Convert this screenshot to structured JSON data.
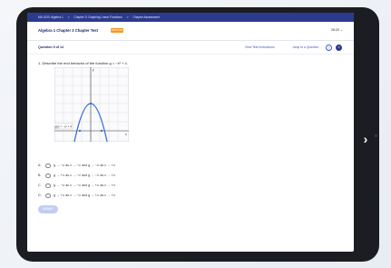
{
  "breadcrumb": {
    "items": [
      "MA 1020: Algebra 1",
      "Chapter 3: Graphing Linear Functions",
      "Chapter Assessment"
    ],
    "separator": ">"
  },
  "header": {
    "title": "Algebra 1 Chapter 3 Chapter Test",
    "badge": "PRACTICE",
    "timer": "28:00 ⌄"
  },
  "question_bar": {
    "counter": "Question 5 of 14",
    "view_instructions": "View Test Instructions",
    "jump_to_question": "Jump to a Question",
    "help_icon_label": "?",
    "menu_icon_label": "≡"
  },
  "question": {
    "prompt": "1. Describe the end behavior of the function g = −x² + 4.",
    "graph_label": "g(x) = −x² + 4",
    "axis_y": "y",
    "axis_x": "x"
  },
  "choices": [
    {
      "letter": "A.",
      "text": "g → −∞ as x → −∞ and g → −∞ as x → +∞"
    },
    {
      "letter": "B.",
      "text": "g → +∞ as x → −∞ and g → −∞ as x → +∞"
    },
    {
      "letter": "C.",
      "text": "g → −∞ as x → −∞ and g → +∞ as x → +∞"
    },
    {
      "letter": "D.",
      "text": "g → +∞ as x → −∞ and g → +∞ as x → +∞"
    }
  ],
  "submit": {
    "label": "SUBMIT"
  },
  "nav": {
    "prev": "‹",
    "next": "›"
  },
  "colors": {
    "brand": "#2b3a8c",
    "accent": "#f39a21",
    "link": "#3a58c9",
    "curve": "#3b6fd1"
  }
}
